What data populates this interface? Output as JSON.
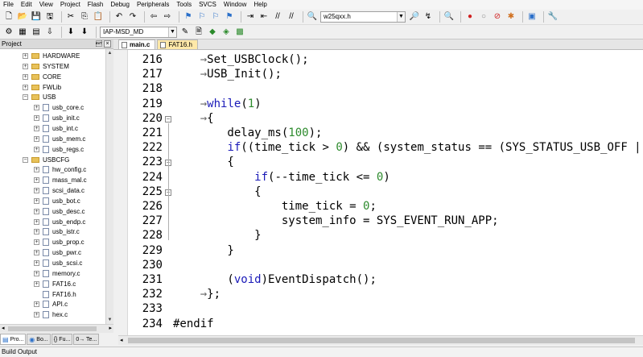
{
  "menu": [
    "File",
    "Edit",
    "View",
    "Project",
    "Flash",
    "Debug",
    "Peripherals",
    "Tools",
    "SVCS",
    "Window",
    "Help"
  ],
  "toolbar": {
    "file_combo": "w25qxx.h",
    "target_combo": "IAP-MSD_MD"
  },
  "project_panel": {
    "title": "Project",
    "pin": "\u0004",
    "close": "×",
    "items": [
      {
        "label": "HARDWARE",
        "type": "folder",
        "level": 1,
        "expander": "+"
      },
      {
        "label": "SYSTEM",
        "type": "folder",
        "level": 1,
        "expander": "+"
      },
      {
        "label": "CORE",
        "type": "folder",
        "level": 1,
        "expander": "+"
      },
      {
        "label": "FWLib",
        "type": "folder",
        "level": 1,
        "expander": "+"
      },
      {
        "label": "USB",
        "type": "folder",
        "level": 1,
        "expander": "−"
      },
      {
        "label": "usb_core.c",
        "type": "file",
        "level": 2,
        "expander": "+"
      },
      {
        "label": "usb_init.c",
        "type": "file",
        "level": 2,
        "expander": "+"
      },
      {
        "label": "usb_int.c",
        "type": "file",
        "level": 2,
        "expander": "+"
      },
      {
        "label": "usb_mem.c",
        "type": "file",
        "level": 2,
        "expander": "+"
      },
      {
        "label": "usb_regs.c",
        "type": "file",
        "level": 2,
        "expander": "+"
      },
      {
        "label": "USBCFG",
        "type": "folder",
        "level": 1,
        "expander": "−"
      },
      {
        "label": "hw_config.c",
        "type": "file",
        "level": 2,
        "expander": "+"
      },
      {
        "label": "mass_mal.c",
        "type": "file",
        "level": 2,
        "expander": "+"
      },
      {
        "label": "scsi_data.c",
        "type": "file",
        "level": 2,
        "expander": "+"
      },
      {
        "label": "usb_bot.c",
        "type": "file",
        "level": 2,
        "expander": "+"
      },
      {
        "label": "usb_desc.c",
        "type": "file",
        "level": 2,
        "expander": "+"
      },
      {
        "label": "usb_endp.c",
        "type": "file",
        "level": 2,
        "expander": "+"
      },
      {
        "label": "usb_istr.c",
        "type": "file",
        "level": 2,
        "expander": "+"
      },
      {
        "label": "usb_prop.c",
        "type": "file",
        "level": 2,
        "expander": "+"
      },
      {
        "label": "usb_pwr.c",
        "type": "file",
        "level": 2,
        "expander": "+"
      },
      {
        "label": "usb_scsi.c",
        "type": "file",
        "level": 2,
        "expander": "+"
      },
      {
        "label": "memory.c",
        "type": "file",
        "level": 2,
        "expander": "+"
      },
      {
        "label": "FAT16.c",
        "type": "file",
        "level": 2,
        "expander": "+"
      },
      {
        "label": "FAT16.h",
        "type": "file",
        "level": 2,
        "expander": ""
      },
      {
        "label": "API.c",
        "type": "file",
        "level": 2,
        "expander": "+"
      },
      {
        "label": "hex.c",
        "type": "file",
        "level": 2,
        "expander": "+"
      }
    ]
  },
  "bottom_tabs": [
    "Pro...",
    "Bo...",
    "{} Fu...",
    "0→ Te..."
  ],
  "editor_tabs": [
    {
      "label": "main.c",
      "active": true
    },
    {
      "label": "FAT16.h",
      "active": false
    }
  ],
  "code_lines": [
    {
      "n": "216",
      "fold": "",
      "tokens": [
        [
          "tab",
          "    →"
        ],
        [
          "t",
          "Set_USBClock();"
        ]
      ]
    },
    {
      "n": "217",
      "fold": "",
      "tokens": [
        [
          "tab",
          "    →"
        ],
        [
          "t",
          "USB_Init();"
        ]
      ]
    },
    {
      "n": "218",
      "fold": "",
      "tokens": [
        [
          "dots",
          "    "
        ],
        [
          "t",
          ""
        ]
      ]
    },
    {
      "n": "219",
      "fold": "",
      "tokens": [
        [
          "tab",
          "    →"
        ],
        [
          "kw",
          "while"
        ],
        [
          "t",
          "("
        ],
        [
          "num",
          "1"
        ],
        [
          "t",
          ")"
        ]
      ]
    },
    {
      "n": "220",
      "fold": "−",
      "tokens": [
        [
          "tab",
          "    →"
        ],
        [
          "t",
          "{"
        ]
      ]
    },
    {
      "n": "221",
      "fold": "",
      "tokens": [
        [
          "t",
          "        delay_ms("
        ],
        [
          "num",
          "100"
        ],
        [
          "t",
          ");"
        ]
      ]
    },
    {
      "n": "222",
      "fold": "",
      "tokens": [
        [
          "t",
          "        "
        ],
        [
          "kw",
          "if"
        ],
        [
          "t",
          "((time_tick > "
        ],
        [
          "num",
          "0"
        ],
        [
          "t",
          ") && (system_status == (SYS_STATUS_USB_OFF |"
        ]
      ]
    },
    {
      "n": "223",
      "fold": "−",
      "tokens": [
        [
          "t",
          "        {"
        ]
      ]
    },
    {
      "n": "224",
      "fold": "",
      "tokens": [
        [
          "t",
          "            "
        ],
        [
          "kw",
          "if"
        ],
        [
          "t",
          "(--time_tick <= "
        ],
        [
          "num",
          "0"
        ],
        [
          "t",
          ")"
        ]
      ]
    },
    {
      "n": "225",
      "fold": "−",
      "tokens": [
        [
          "t",
          "            {"
        ]
      ]
    },
    {
      "n": "226",
      "fold": "",
      "tokens": [
        [
          "t",
          "                time_tick = "
        ],
        [
          "num",
          "0"
        ],
        [
          "t",
          ";"
        ]
      ]
    },
    {
      "n": "227",
      "fold": "",
      "tokens": [
        [
          "t",
          "                system_info = SYS_EVENT_RUN_APP;"
        ]
      ]
    },
    {
      "n": "228",
      "fold": "",
      "tokens": [
        [
          "t",
          "            }"
        ]
      ]
    },
    {
      "n": "229",
      "fold": "",
      "tokens": [
        [
          "t",
          "        }"
        ]
      ]
    },
    {
      "n": "230",
      "fold": "",
      "tokens": [
        [
          "t",
          ""
        ]
      ]
    },
    {
      "n": "231",
      "fold": "",
      "tokens": [
        [
          "t",
          "        ("
        ],
        [
          "kw",
          "void"
        ],
        [
          "t",
          ")EventDispatch();"
        ]
      ]
    },
    {
      "n": "232",
      "fold": "",
      "tokens": [
        [
          "tab",
          "    →"
        ],
        [
          "t",
          "};"
        ]
      ]
    },
    {
      "n": "233",
      "fold": "",
      "tokens": [
        [
          "t",
          ""
        ]
      ]
    },
    {
      "n": "234",
      "fold": "",
      "tokens": [
        [
          "t",
          "#endif"
        ]
      ]
    }
  ],
  "build_output": {
    "title": "Build Output"
  },
  "colors": {
    "keyword": "#1a1ab8",
    "number": "#2d8b2d"
  }
}
